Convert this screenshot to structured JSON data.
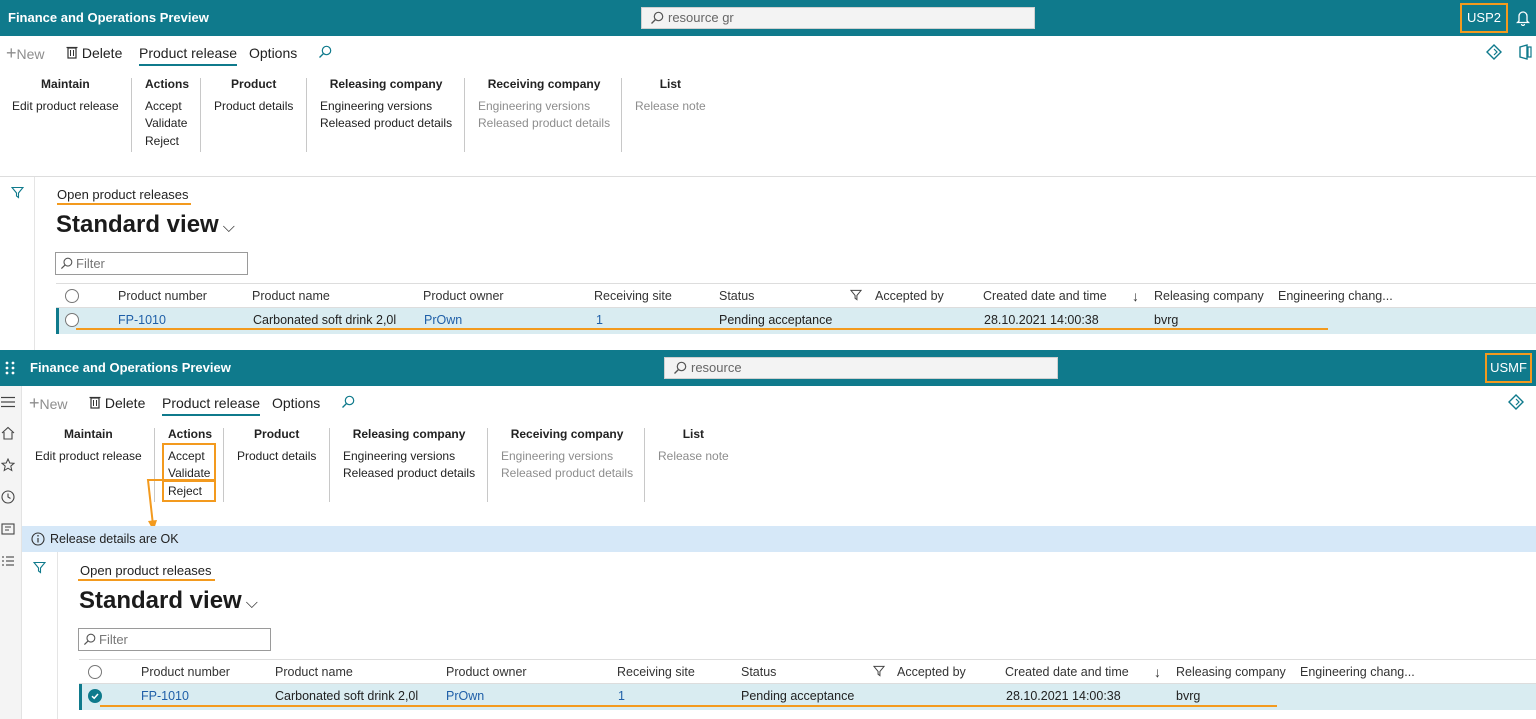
{
  "colors": {
    "header": "#0f7a8c",
    "highlight": "#f39a1e",
    "selected_row": "#d9ecf1",
    "info_bar": "#d6e8f8"
  },
  "top": {
    "app_title": "Finance and Operations Preview",
    "search_value": "resource gr",
    "company": "USP2",
    "toolbar": {
      "new": "New",
      "delete": "Delete",
      "tab_active": "Product release",
      "tab_options": "Options"
    },
    "groups": {
      "maintain": {
        "header": "Maintain",
        "items": [
          "Edit product release"
        ]
      },
      "actions": {
        "header": "Actions",
        "items": [
          "Accept",
          "Validate",
          "Reject"
        ]
      },
      "product": {
        "header": "Product",
        "items": [
          "Product details"
        ]
      },
      "releasing": {
        "header": "Releasing company",
        "items": [
          "Engineering versions",
          "Released product details"
        ]
      },
      "receiving": {
        "header": "Receiving company",
        "items": [
          "Engineering versions",
          "Released product details"
        ]
      },
      "list": {
        "header": "List",
        "items": [
          "Release note"
        ]
      }
    },
    "breadcrumb": "Open product releases",
    "view_title": "Standard view",
    "filter_placeholder": "Filter",
    "columns": [
      "Product number",
      "Product name",
      "Product owner",
      "Receiving site",
      "Status",
      "Accepted by",
      "Created date and time",
      "Releasing company",
      "Engineering chang..."
    ],
    "row": {
      "product_number": "FP-1010",
      "product_name": "Carbonated soft drink 2,0l",
      "product_owner": "PrOwn",
      "receiving_site": "1",
      "status": "Pending acceptance",
      "accepted_by": "",
      "created": "28.10.2021 14:00:38",
      "releasing_company": "bvrg",
      "engineering_change": ""
    }
  },
  "bottom": {
    "app_title": "Finance and Operations Preview",
    "search_value": "resource",
    "company": "USMF",
    "toolbar": {
      "new": "New",
      "delete": "Delete",
      "tab_active": "Product release",
      "tab_options": "Options"
    },
    "groups": {
      "maintain": {
        "header": "Maintain",
        "items": [
          "Edit product release"
        ]
      },
      "actions": {
        "header": "Actions",
        "items": [
          "Accept",
          "Validate",
          "Reject"
        ]
      },
      "product": {
        "header": "Product",
        "items": [
          "Product details"
        ]
      },
      "releasing": {
        "header": "Releasing company",
        "items": [
          "Engineering versions",
          "Released product details"
        ]
      },
      "receiving": {
        "header": "Receiving company",
        "items": [
          "Engineering versions",
          "Released product details"
        ]
      },
      "list": {
        "header": "List",
        "items": [
          "Release note"
        ]
      }
    },
    "info_message": "Release details are OK",
    "breadcrumb": "Open product releases",
    "view_title": "Standard view",
    "filter_placeholder": "Filter",
    "columns": [
      "Product number",
      "Product name",
      "Product owner",
      "Receiving site",
      "Status",
      "Accepted by",
      "Created date and time",
      "Releasing company",
      "Engineering chang..."
    ],
    "row": {
      "product_number": "FP-1010",
      "product_name": "Carbonated soft drink 2,0l",
      "product_owner": "PrOwn",
      "receiving_site": "1",
      "status": "Pending acceptance",
      "accepted_by": "",
      "created": "28.10.2021 14:00:38",
      "releasing_company": "bvrg",
      "engineering_change": ""
    }
  }
}
